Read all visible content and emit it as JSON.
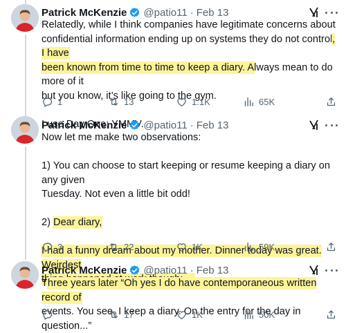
{
  "colors": {
    "accent": "#1d9bf0",
    "highlight": "#fdf49a",
    "muted": "#536471"
  },
  "tweets": [
    {
      "name": "Patrick McKenzie",
      "handle": "@patio11",
      "date": "Feb 13",
      "lines": {
        "a": "Relatedly, while I think companies have legitimate concerns about",
        "b1": "confidential information ending up on systems they do not control",
        "b2": ", I have",
        "c1": "been known from time to time to keep a diary. A",
        "c2": "lways mean to do more of it",
        "d": "but you know, it’s like going to the gym.",
        "e": "I use Day One; YMMV."
      },
      "stats": {
        "replies": "1",
        "reposts": "13",
        "likes": "1.1K",
        "views": "65K"
      }
    },
    {
      "name": "Patrick McKenzie",
      "handle": "@patio11",
      "date": "Feb 13",
      "lines": {
        "a": "Now let me make two observations:",
        "b": "1) You can choose to start keeping or resume keeping a diary on any given",
        "c": "Tuesday. Not even a little bit odd!",
        "d1": "2) ",
        "d2": "Dear diary,",
        "e": "I had a funny dream about my mother. Dinner today was great. Weirdest",
        "f": "thing happened at work though: ..."
      },
      "stats": {
        "replies": "3",
        "reposts": "22",
        "likes": "1K",
        "views": "59K"
      }
    },
    {
      "name": "Patrick McKenzie",
      "handle": "@patio11",
      "date": "Feb 13",
      "lines": {
        "a1": "T",
        "a2": "hree years later “Oh yes I do have contemporaneous written record of",
        "b": "events. You see, I keep a diary. On the entry for the day in question...”"
      },
      "stats": {
        "replies": "",
        "reposts": "17",
        "likes": "1K",
        "views": "50K"
      }
    }
  ]
}
